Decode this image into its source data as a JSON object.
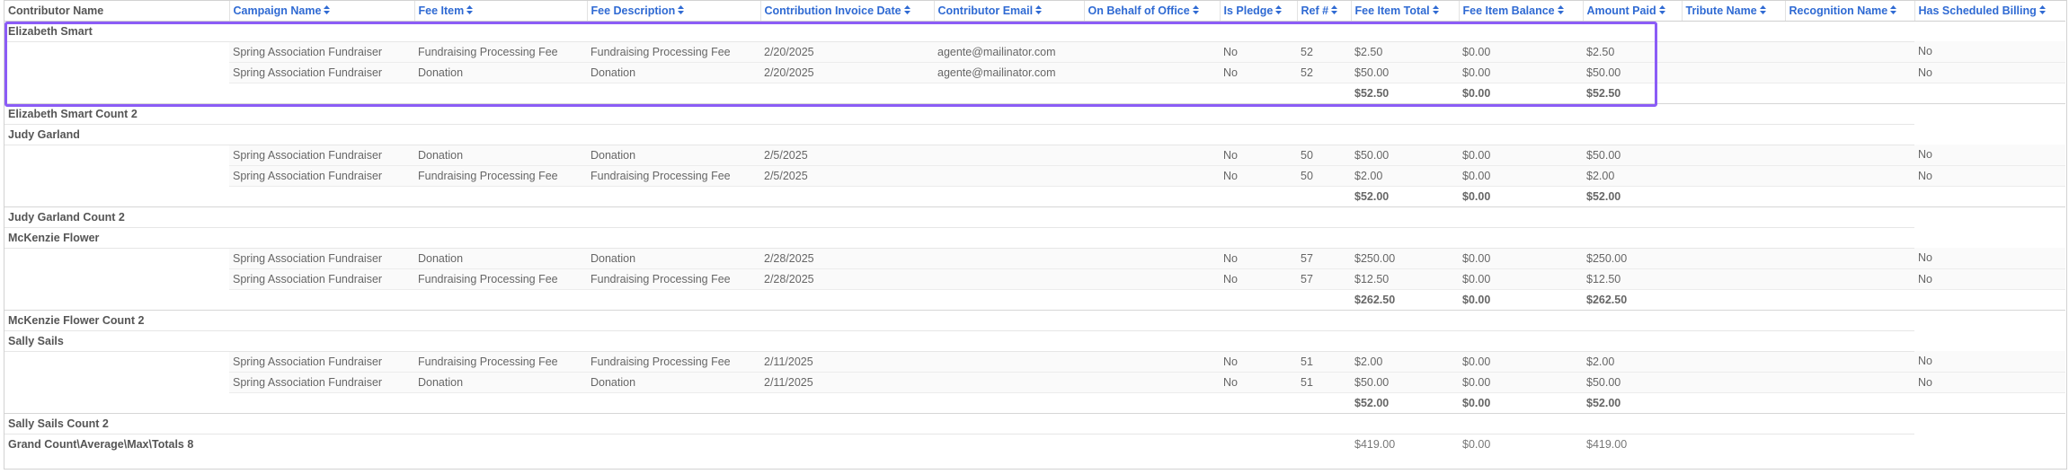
{
  "columns": [
    {
      "label": "Contributor Name",
      "sortable": false
    },
    {
      "label": "Campaign Name",
      "sortable": true
    },
    {
      "label": "Fee Item",
      "sortable": true
    },
    {
      "label": "Fee Description",
      "sortable": true
    },
    {
      "label": "Contribution Invoice Date",
      "sortable": true
    },
    {
      "label": "Contributor Email",
      "sortable": true
    },
    {
      "label": "On Behalf of Office",
      "sortable": true
    },
    {
      "label": "Is Pledge",
      "sortable": true
    },
    {
      "label": "Ref #",
      "sortable": true
    },
    {
      "label": "Fee Item Total",
      "sortable": true
    },
    {
      "label": "Fee Item Balance",
      "sortable": true
    },
    {
      "label": "Amount Paid",
      "sortable": true
    },
    {
      "label": "Tribute Name",
      "sortable": true
    },
    {
      "label": "Recognition Name",
      "sortable": true
    },
    {
      "label": "Has Scheduled Billing",
      "sortable": true
    }
  ],
  "sort_icon": "sort-updown-icon",
  "groups": [
    {
      "name": "Elizabeth Smart",
      "rows": [
        [
          "Spring Association Fundraiser",
          "Fundraising Processing Fee",
          "Fundraising Processing Fee",
          "2/20/2025",
          "agente@mailinator.com",
          "",
          "No",
          "52",
          "$2.50",
          "$0.00",
          "$2.50",
          "",
          "",
          "No"
        ],
        [
          "Spring Association Fundraiser",
          "Donation",
          "Donation",
          "2/20/2025",
          "agente@mailinator.com",
          "",
          "No",
          "52",
          "$50.00",
          "$0.00",
          "$50.00",
          "",
          "",
          "No"
        ]
      ],
      "subtotal": {
        "total": "$52.50",
        "balance": "$0.00",
        "paid": "$52.50"
      },
      "count_label": "Elizabeth Smart Count 2"
    },
    {
      "name": "Judy Garland",
      "rows": [
        [
          "Spring Association Fundraiser",
          "Donation",
          "Donation",
          "2/5/2025",
          "",
          "",
          "No",
          "50",
          "$50.00",
          "$0.00",
          "$50.00",
          "",
          "",
          "No"
        ],
        [
          "Spring Association Fundraiser",
          "Fundraising Processing Fee",
          "Fundraising Processing Fee",
          "2/5/2025",
          "",
          "",
          "No",
          "50",
          "$2.00",
          "$0.00",
          "$2.00",
          "",
          "",
          "No"
        ]
      ],
      "subtotal": {
        "total": "$52.00",
        "balance": "$0.00",
        "paid": "$52.00"
      },
      "count_label": "Judy Garland Count 2"
    },
    {
      "name": "McKenzie Flower",
      "rows": [
        [
          "Spring Association Fundraiser",
          "Donation",
          "Donation",
          "2/28/2025",
          "",
          "",
          "No",
          "57",
          "$250.00",
          "$0.00",
          "$250.00",
          "",
          "",
          "No"
        ],
        [
          "Spring Association Fundraiser",
          "Fundraising Processing Fee",
          "Fundraising Processing Fee",
          "2/28/2025",
          "",
          "",
          "No",
          "57",
          "$12.50",
          "$0.00",
          "$12.50",
          "",
          "",
          "No"
        ]
      ],
      "subtotal": {
        "total": "$262.50",
        "balance": "$0.00",
        "paid": "$262.50"
      },
      "count_label": "McKenzie Flower Count 2"
    },
    {
      "name": "Sally Sails",
      "rows": [
        [
          "Spring Association Fundraiser",
          "Fundraising Processing Fee",
          "Fundraising Processing Fee",
          "2/11/2025",
          "",
          "",
          "No",
          "51",
          "$2.00",
          "$0.00",
          "$2.00",
          "",
          "",
          "No"
        ],
        [
          "Spring Association Fundraiser",
          "Donation",
          "Donation",
          "2/11/2025",
          "",
          "",
          "No",
          "51",
          "$50.00",
          "$0.00",
          "$50.00",
          "",
          "",
          "No"
        ]
      ],
      "subtotal": {
        "total": "$52.00",
        "balance": "$0.00",
        "paid": "$52.00"
      },
      "count_label": "Sally Sails Count 2"
    }
  ],
  "grand": {
    "label": "Grand Count\\Average\\Max\\Totals 8",
    "total": "$419.00",
    "balance": "$0.00",
    "paid": "$419.00"
  },
  "colors": {
    "header_text": "#2f6ad3",
    "highlight": "#8b5cf6"
  }
}
